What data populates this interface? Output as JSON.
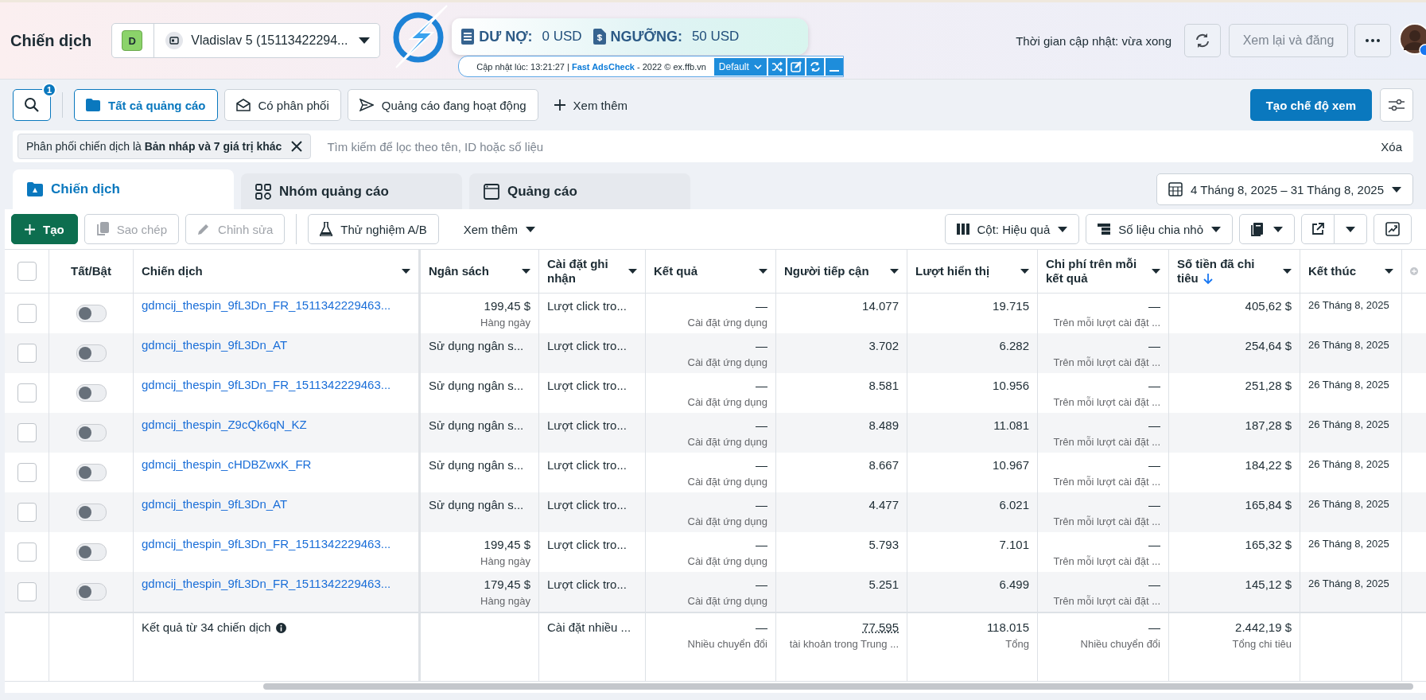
{
  "header": {
    "title": "Chiến dịch",
    "account": {
      "badge": "D",
      "name": "Vladislav 5 (15113422294..."
    },
    "extension": {
      "debt_label": "DƯ NỢ:",
      "debt_value": "0 USD",
      "threshold_label": "NGƯỠNG:",
      "threshold_value": "50 USD",
      "info": "Cập nhật lúc: 13:21:27 | **Fast AdsCheck** - 2022 © ex.ffb.vn",
      "profile": "Default"
    },
    "update_status": "Thời gian cập nhật: vừa xong",
    "review_button": "Xem lại và đăng"
  },
  "search": {
    "badge": "1"
  },
  "quick_filters": [
    {
      "label": "Tất cả quảng cáo",
      "selected": true,
      "kind": "folder"
    },
    {
      "label": "Có phân phối",
      "selected": false,
      "kind": "envelope"
    },
    {
      "label": "Quảng cáo đang hoạt động",
      "selected": false,
      "kind": "send"
    }
  ],
  "more_filters": "Xem thêm",
  "create_view": "Tạo chế độ xem",
  "filter_bar": {
    "chip": "Phân phối chiến dịch là **Bản nháp và 7 giá trị khác**",
    "placeholder": "Tìm kiếm để lọc theo tên, ID hoặc số liệu",
    "clear": "Xóa"
  },
  "level_tabs": [
    {
      "label": "Chiến dịch",
      "selected": true,
      "kind": "campaign"
    },
    {
      "label": "Nhóm quảng cáo",
      "selected": false,
      "kind": "grid"
    },
    {
      "label": "Quảng cáo",
      "selected": false,
      "kind": "window"
    }
  ],
  "date_range": "4 Tháng 8, 2025 – 31 Tháng 8, 2025",
  "toolbar": {
    "actions": [
      {
        "label": "Tạo",
        "kind": "create",
        "disabled": false
      },
      {
        "label": "Sao chép",
        "kind": "duplicate",
        "disabled": true
      },
      {
        "label": "Chỉnh sửa",
        "kind": "edit",
        "disabled": true
      },
      {
        "label": "Thử nghiệm A/B",
        "kind": "test",
        "disabled": false
      }
    ],
    "more": "Xem thêm",
    "columns": "Cột: Hiệu quả",
    "breakdown": "Số liệu chia nhỏ"
  },
  "table": {
    "select_all": {
      "checked": false
    },
    "columns": [
      {
        "label": "Tất/Bật",
        "menu": false,
        "sorted": false
      },
      {
        "label": "Chiến dịch",
        "menu": true,
        "sorted": false
      },
      {
        "label": "Ngân sách",
        "menu": true,
        "sorted": false
      },
      {
        "label": "Cài đặt ghi nhận",
        "menu": true,
        "sorted": false
      },
      {
        "label": "Kết quả",
        "menu": true,
        "sorted": false
      },
      {
        "label": "Người tiếp cận",
        "menu": true,
        "sorted": false
      },
      {
        "label": "Lượt hiển thị",
        "menu": true,
        "sorted": false
      },
      {
        "label": "Chi phí trên mỗi kết quả",
        "menu": true,
        "sorted": false
      },
      {
        "label": "Số tiền đã chi tiêu",
        "menu": true,
        "sorted": true
      },
      {
        "label": "Kết thúc",
        "menu": true,
        "sorted": false
      }
    ],
    "rows": [
      {
        "checked": false,
        "on": false,
        "name": "gdmcij_thespin_9fL3Dn_FR_1511342229463...",
        "budget": "199,45 $",
        "budget_period": "Hàng ngày",
        "attribution": "Lượt click tro...",
        "result": "—",
        "result_type": "Cài đặt ứng dụng",
        "reach": "14.077",
        "impressions": "19.715",
        "cost_per_result": "—",
        "cost_type": "Trên mỗi lượt cài đặt ...",
        "amount_spent": "405,62 $",
        "end": "26 Tháng 8, 2025"
      },
      {
        "checked": false,
        "on": false,
        "name": "gdmcij_thespin_9fL3Dn_AT",
        "budget": "Sử dụng ngân s...",
        "attribution": "Lượt click tro...",
        "result": "—",
        "result_type": "Cài đặt ứng dụng",
        "reach": "3.702",
        "impressions": "6.282",
        "cost_per_result": "—",
        "cost_type": "Trên mỗi lượt cài đặt ...",
        "amount_spent": "254,64 $",
        "end": "26 Tháng 8, 2025"
      },
      {
        "checked": false,
        "on": false,
        "name": "gdmcij_thespin_9fL3Dn_FR_1511342229463...",
        "budget": "Sử dụng ngân s...",
        "attribution": "Lượt click tro...",
        "result": "—",
        "result_type": "Cài đặt ứng dụng",
        "reach": "8.581",
        "impressions": "10.956",
        "cost_per_result": "—",
        "cost_type": "Trên mỗi lượt cài đặt ...",
        "amount_spent": "251,28 $",
        "end": "26 Tháng 8, 2025"
      },
      {
        "checked": false,
        "on": false,
        "name": "gdmcij_thespin_Z9cQk6qN_KZ",
        "budget": "Sử dụng ngân s...",
        "attribution": "Lượt click tro...",
        "result": "—",
        "result_type": "Cài đặt ứng dụng",
        "reach": "8.489",
        "impressions": "11.081",
        "cost_per_result": "—",
        "cost_type": "Trên mỗi lượt cài đặt ...",
        "amount_spent": "187,28 $",
        "end": "26 Tháng 8, 2025"
      },
      {
        "checked": false,
        "on": false,
        "name": "gdmcij_thespin_cHDBZwxK_FR",
        "budget": "Sử dụng ngân s...",
        "attribution": "Lượt click tro...",
        "result": "—",
        "result_type": "Cài đặt ứng dụng",
        "reach": "8.667",
        "impressions": "10.967",
        "cost_per_result": "—",
        "cost_type": "Trên mỗi lượt cài đặt ...",
        "amount_spent": "184,22 $",
        "end": "26 Tháng 8, 2025"
      },
      {
        "checked": false,
        "on": false,
        "name": "gdmcij_thespin_9fL3Dn_AT",
        "budget": "Sử dụng ngân s...",
        "attribution": "Lượt click tro...",
        "result": "—",
        "result_type": "Cài đặt ứng dụng",
        "reach": "4.477",
        "impressions": "6.021",
        "cost_per_result": "—",
        "cost_type": "Trên mỗi lượt cài đặt ...",
        "amount_spent": "165,84 $",
        "end": "26 Tháng 8, 2025"
      },
      {
        "checked": false,
        "on": false,
        "name": "gdmcij_thespin_9fL3Dn_FR_1511342229463...",
        "budget": "199,45 $",
        "budget_period": "Hàng ngày",
        "attribution": "Lượt click tro...",
        "result": "—",
        "result_type": "Cài đặt ứng dụng",
        "reach": "5.793",
        "impressions": "7.101",
        "cost_per_result": "—",
        "cost_type": "Trên mỗi lượt cài đặt ...",
        "amount_spent": "165,32 $",
        "end": "26 Tháng 8, 2025"
      },
      {
        "checked": false,
        "on": false,
        "name": "gdmcij_thespin_9fL3Dn_FR_1511342229463...",
        "budget": "179,45 $",
        "budget_period": "Hàng ngày",
        "attribution": "Lượt click tro...",
        "result": "—",
        "result_type": "Cài đặt ứng dụng",
        "reach": "5.251",
        "impressions": "6.499",
        "cost_per_result": "—",
        "cost_type": "Trên mỗi lượt cài đặt ...",
        "amount_spent": "145,12 $",
        "end": "26 Tháng 8, 2025"
      }
    ],
    "footer": {
      "label": "Kết quả từ 34 chiến dịch",
      "attribution": "Cài đặt nhiều ...",
      "result": "—",
      "result_note": "Nhiều chuyển đổi",
      "reach": "77.595",
      "reach_note": "tài khoản trong Trung ...",
      "impressions": "118.015",
      "impressions_note": "Tổng",
      "cost_per_result": "—",
      "cost_note": "Nhiều chuyển đổi",
      "amount_spent": "2.442,19 $",
      "amount_note": "Tổng chi tiêu"
    }
  }
}
